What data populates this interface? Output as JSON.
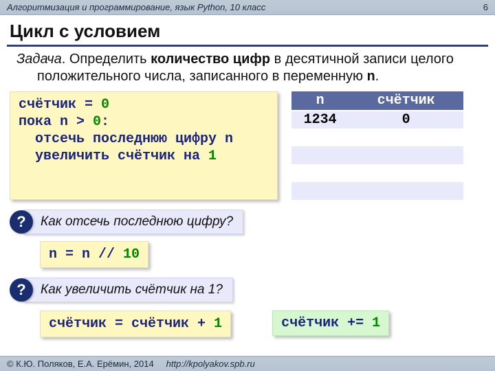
{
  "header": {
    "course": "Алгоритмизация и программирование, язык Python, 10 класс",
    "page": "6"
  },
  "title": "Цикл с условием",
  "task": {
    "label": "Задача",
    "text_before": ". Определить ",
    "bold": "количество цифр",
    "text_after": " в десятичной записи целого положительного числа, записанного в переменную ",
    "var": "n",
    "dot": "."
  },
  "pseudocode": {
    "l1a": "счётчик = ",
    "l1b": "0",
    "l2a": "пока n > ",
    "l2b": "0",
    "l2c": ":",
    "l3": "  отсечь последнюю цифру n",
    "l4a": "  увеличить счётчик на ",
    "l4b": "1"
  },
  "trace": {
    "h1": "n",
    "h2": "счётчик",
    "rows": [
      {
        "n": "1234",
        "c": "0"
      },
      {
        "n": "",
        "c": ""
      },
      {
        "n": "",
        "c": ""
      },
      {
        "n": "",
        "c": ""
      },
      {
        "n": "",
        "c": ""
      }
    ]
  },
  "q1": {
    "badge": "?",
    "text": "Как отсечь последнюю цифру?"
  },
  "snippet1": {
    "a": "n = n // ",
    "b": "10"
  },
  "q2": {
    "badge": "?",
    "text": "Как увеличить счётчик на 1?"
  },
  "snippet2": {
    "a": "счётчик = счётчик + ",
    "b": "1"
  },
  "snippet3": {
    "a": "счётчик += ",
    "b": "1"
  },
  "footer": {
    "copyright": "© К.Ю. Поляков, Е.А. Ерёмин, 2014",
    "url": "http://kpolyakov.spb.ru"
  }
}
